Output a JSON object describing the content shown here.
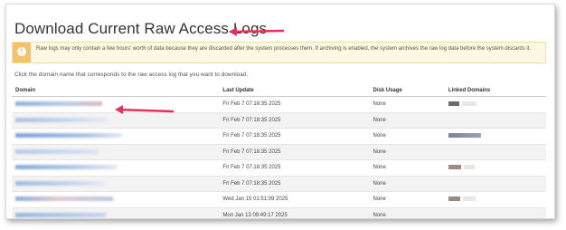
{
  "page": {
    "title": "Download Current Raw Access Logs",
    "notice": "Raw logs may only contain a few hours' worth of data because they are discarded after the system processes them. If archiving is enabled, the system archives the raw log data before the system discards it.",
    "instruction": "Click the domain name that corresponds to the raw access log that you want to download."
  },
  "table": {
    "headers": [
      "Domain",
      "Last Update",
      "Disk Usage",
      "Linked Domains"
    ],
    "rows": [
      {
        "last_update": "Fri Feb 7 07:18:35 2025",
        "disk_usage": "None"
      },
      {
        "last_update": "Fri Feb 7 07:18:35 2025",
        "disk_usage": "None"
      },
      {
        "last_update": "Fri Feb 7 07:18:35 2025",
        "disk_usage": "None"
      },
      {
        "last_update": "Fri Feb 7 07:18:35 2025",
        "disk_usage": "None"
      },
      {
        "last_update": "Fri Feb 7 07:18:35 2025",
        "disk_usage": "None"
      },
      {
        "last_update": "Fri Feb 7 07:18:35 2025",
        "disk_usage": "None"
      },
      {
        "last_update": "Wed Jan 15 01:51:09 2025",
        "disk_usage": "None"
      },
      {
        "last_update": "Mon Jan 13 09:49:17 2025",
        "disk_usage": "None"
      }
    ]
  },
  "colors": {
    "annotation_arrow": "#e8305a",
    "notice_bg": "#fcf8e1",
    "notice_icon": "#f5c26a",
    "domain_link_redacted": "#7ea6d8"
  },
  "icons": {
    "notice": "warning-icon",
    "annotation": "arrow-annotation-icon"
  }
}
